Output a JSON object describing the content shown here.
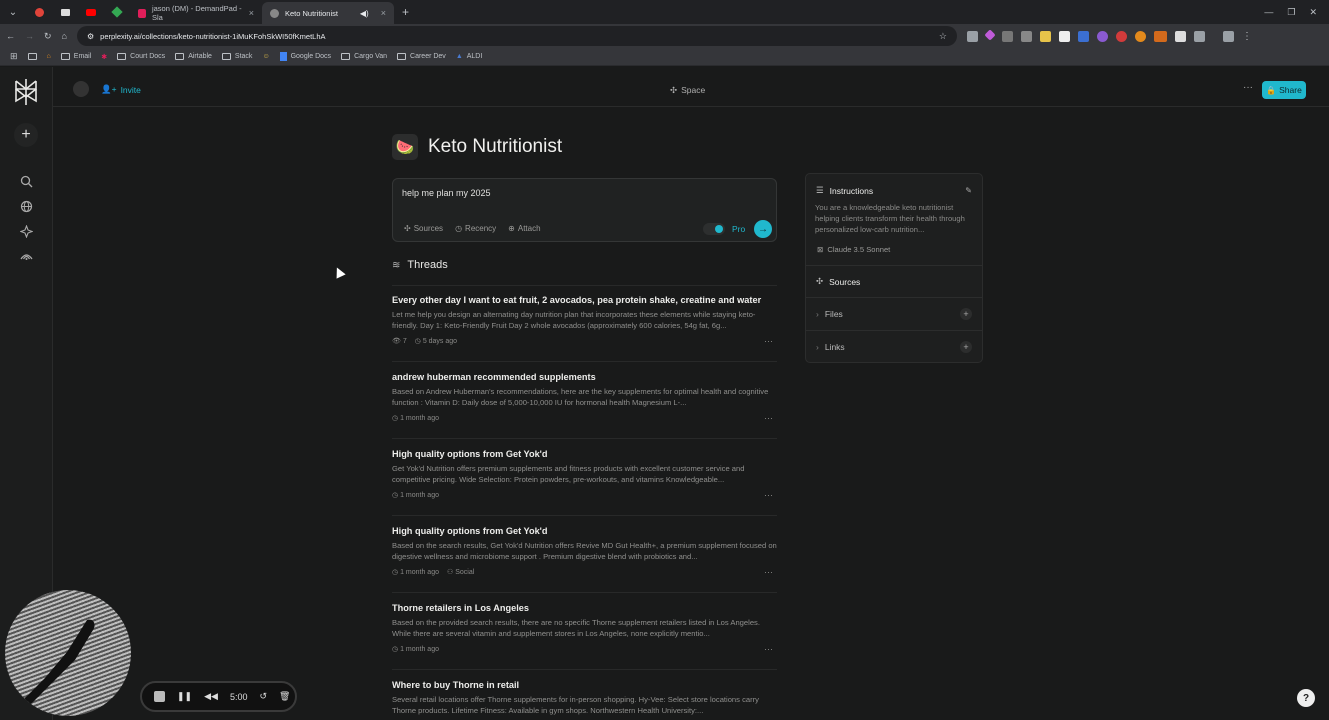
{
  "browser": {
    "tabs": [
      {
        "label": "jason (DM) - DemandPad - Sla",
        "close": "×"
      },
      {
        "label": "Keto Nutritionist",
        "close": "×"
      }
    ],
    "new_tab": "+",
    "url": "perplexity.ai/collections/keto-nutritionist-1iMuKFohSkWI50fKmetLhA",
    "bookmarks": [
      "Email",
      "Court Docs",
      "Airtable",
      "Stack",
      "Google Docs",
      "Cargo Van",
      "Career Dev",
      "ALDI"
    ],
    "colors": {
      "accent": "#20b8cd",
      "bg": "#191a1a"
    }
  },
  "topbar": {
    "invite": "Invite",
    "space": "Space",
    "more": "···",
    "share": "Share"
  },
  "collection": {
    "emoji": "🍉",
    "title": "Keto Nutritionist"
  },
  "ask": {
    "value": "help me plan my 2025",
    "sources": "Sources",
    "recency": "Recency",
    "attach": "Attach",
    "pro": "Pro"
  },
  "threads": {
    "heading": "Threads",
    "items": [
      {
        "title": "Every other day I want to eat fruit, 2 avocados, pea protein shake, creatine and water",
        "desc": "Let me help you design an alternating day nutrition plan that incorporates these elements while staying keto-friendly. Day 1: Keto-Friendly Fruit Day 2 whole avocados (approximately 600 calories, 54g fat, 6g...",
        "views": "7",
        "time": "5 days ago",
        "tag": ""
      },
      {
        "title": "andrew huberman recommended supplements",
        "desc": "Based on Andrew Huberman's recommendations, here are the key supplements for optimal health and cognitive function : Vitamin D: Daily dose of 5,000-10,000 IU for hormonal health Magnesium L-...",
        "views": "",
        "time": "1 month ago",
        "tag": ""
      },
      {
        "title": "High quality options from Get Yok'd",
        "desc": "Get Yok'd Nutrition offers premium supplements and fitness products with excellent customer service and competitive pricing. Wide Selection: Protein powders, pre-workouts, and vitamins Knowledgeable...",
        "views": "",
        "time": "1 month ago",
        "tag": ""
      },
      {
        "title": "High quality options from Get Yok'd",
        "desc": "Based on the search results, Get Yok'd Nutrition offers Revive MD Gut Health+, a premium supplement focused on digestive wellness and microbiome support . Premium digestive blend with probiotics and...",
        "views": "",
        "time": "1 month ago",
        "tag": "Social"
      },
      {
        "title": "Thorne retailers in Los Angeles",
        "desc": "Based on the provided search results, there are no specific Thorne supplement retailers listed in Los Angeles. While there are several vitamin and supplement stores in Los Angeles, none explicitly mentio...",
        "views": "",
        "time": "1 month ago",
        "tag": ""
      },
      {
        "title": "Where to buy Thorne in retail",
        "desc": "Several retail locations offer Thorne supplements for in-person shopping. Hy-Vee: Select store locations carry Thorne products. Lifetime Fitness: Available in gym shops. Northwestern Health University:...",
        "views": "",
        "time": "",
        "tag": ""
      }
    ]
  },
  "panel": {
    "instructions": "Instructions",
    "instructions_text": "You are a knowledgeable keto nutritionist helping clients transform their health through personalized low-carb nutrition...",
    "model": "Claude 3.5 Sonnet",
    "sources": "Sources",
    "files": "Files",
    "links": "Links"
  },
  "recorder": {
    "time": "5:00"
  },
  "help": "?"
}
